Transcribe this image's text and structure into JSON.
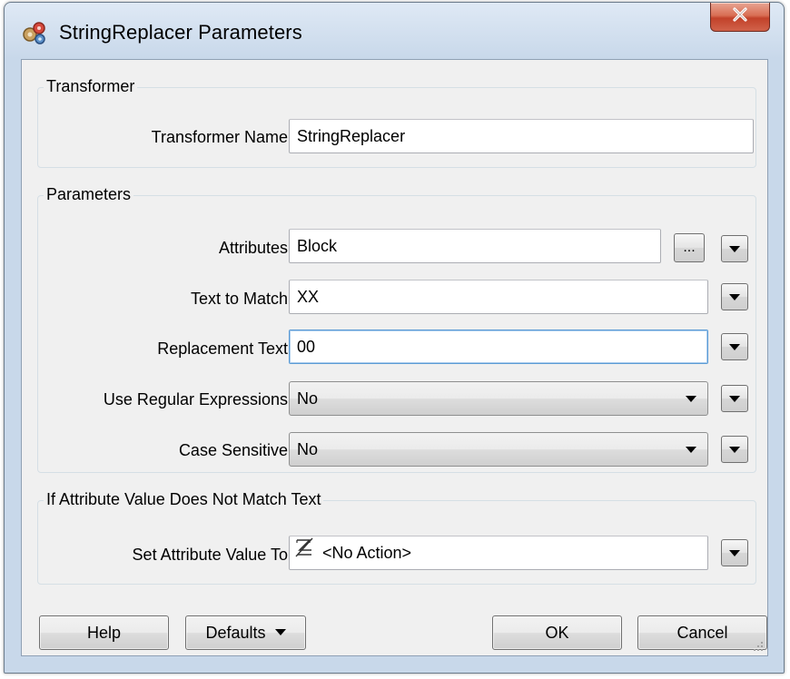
{
  "window": {
    "title": "StringReplacer Parameters",
    "close_label": "X"
  },
  "transformer_group": {
    "title": "Transformer",
    "name_label": "Transformer Name:",
    "name_value": "StringReplacer"
  },
  "parameters_group": {
    "title": "Parameters",
    "attributes_label": "Attributes:",
    "attributes_value": "Block",
    "ellipsis_label": "...",
    "text_to_match_label": "Text to Match:",
    "text_to_match_value": "XX",
    "replacement_text_label": "Replacement Text:",
    "replacement_text_value": "00",
    "use_regex_label": "Use Regular Expressions:",
    "use_regex_value": "No",
    "case_sensitive_label": "Case Sensitive:",
    "case_sensitive_value": "No"
  },
  "no_match_group": {
    "title": "If Attribute Value Does Not Match Text",
    "set_value_label": "Set Attribute Value To:",
    "set_value_value": "<No Action>"
  },
  "footer": {
    "help_label": "Help",
    "defaults_label": "Defaults",
    "ok_label": "OK",
    "cancel_label": "Cancel"
  },
  "icons": {
    "app": "gears-icon",
    "no_action": "no-action-icon",
    "dropdown": "triangle-down-icon"
  }
}
